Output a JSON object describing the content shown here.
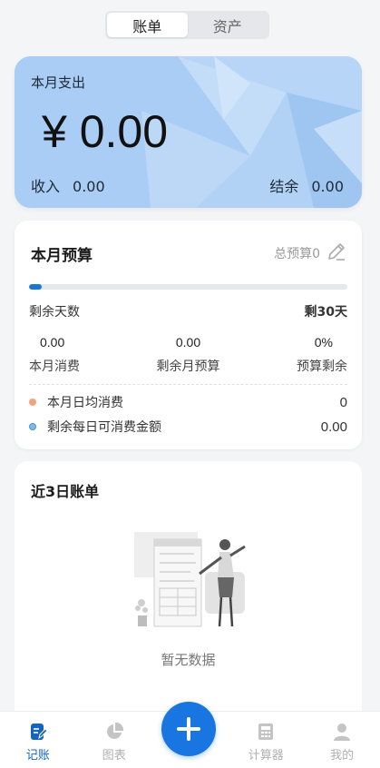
{
  "tabs": [
    {
      "label": "账单",
      "active": true
    },
    {
      "label": "资产",
      "active": false
    }
  ],
  "expense": {
    "label": "本月支出",
    "amount": "¥ 0.00",
    "income_label": "收入",
    "income_value": "0.00",
    "balance_label": "结余",
    "balance_value": "0.00",
    "bg_color": "#a9cdf4"
  },
  "budget": {
    "title": "本月预算",
    "total_label": "总预算0",
    "progress": 0.04,
    "remaining_days_label": "剩余天数",
    "remaining_days_value": "剩30天",
    "stats": [
      {
        "value": "0.00",
        "label": "本月消费"
      },
      {
        "value": "0.00",
        "label": "剩余月预算"
      },
      {
        "value": "0%",
        "label": "预算剩余"
      }
    ],
    "rows": [
      {
        "label": "本月日均消费",
        "value": "0",
        "dot_color": "#f4a27d"
      },
      {
        "label": "剩余每日可消费金额",
        "value": "0.00",
        "dot_color": "#7fbde8"
      }
    ],
    "accent_color": "#1976d2"
  },
  "recent": {
    "title": "近3日账单",
    "empty_text": "暂无数据"
  },
  "nav": {
    "items": [
      {
        "label": "记账",
        "icon": "bill-icon",
        "active": true
      },
      {
        "label": "图表",
        "icon": "chart-icon",
        "active": false
      },
      {
        "label": "计算器",
        "icon": "calculator-icon",
        "active": false
      },
      {
        "label": "我的",
        "icon": "user-icon",
        "active": false
      }
    ],
    "fab_icon": "plus-icon"
  }
}
